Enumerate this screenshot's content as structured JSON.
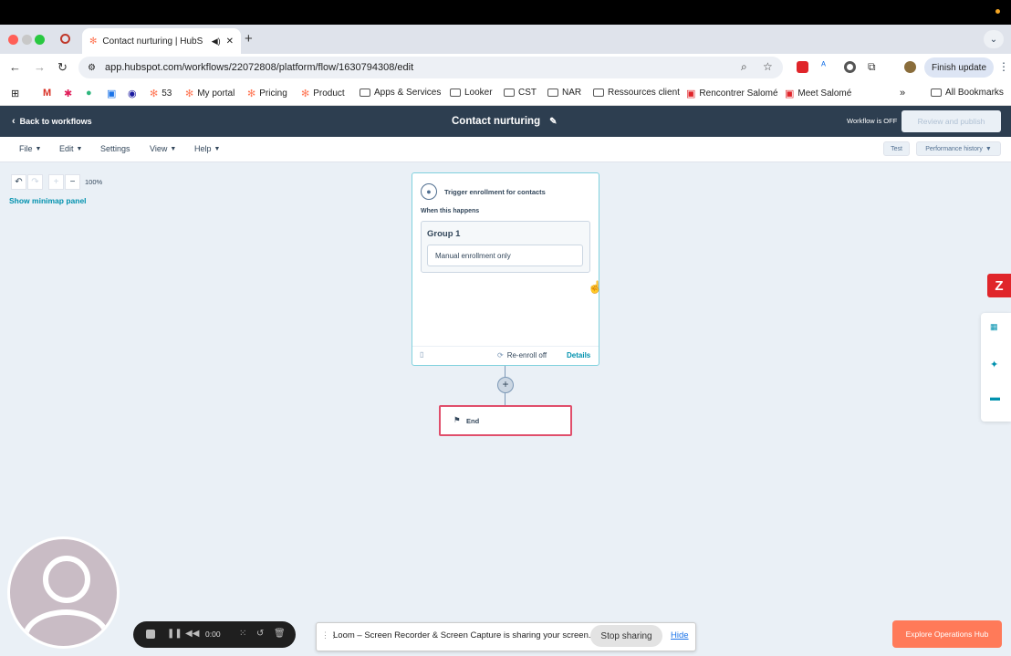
{
  "browser": {
    "tab_title": "Contact nurturing | HubS",
    "address": "app.hubspot.com/workflows/22072808/platform/flow/1630794308/edit",
    "finish_update": "Finish update",
    "bookmarks": [
      "53",
      "My portal",
      "Pricing",
      "Product",
      "Apps & Services",
      "Looker",
      "CST",
      "NAR",
      "Ressources client",
      "Rencontrer Salomé",
      "Meet Salomé"
    ],
    "all_bookmarks": "All Bookmarks"
  },
  "header": {
    "back_label": "Back to workflows",
    "title": "Contact nurturing",
    "status": "Workflow is OFF",
    "review_label": "Review and publish"
  },
  "menu": {
    "file": "File",
    "edit": "Edit",
    "settings": "Settings",
    "view": "View",
    "help": "Help",
    "test": "Test",
    "performance": "Performance history"
  },
  "canvas": {
    "zoom": "100%",
    "minimap": "Show minimap panel"
  },
  "trigger": {
    "title": "Trigger enrollment for contacts",
    "when_label": "When this happens",
    "group_title": "Group 1",
    "group_value": "Manual enrollment only",
    "reenroll": "Re-enroll off",
    "details": "Details"
  },
  "end_node": {
    "label": "End"
  },
  "loom": {
    "time": "0:00",
    "share_text": "Loom – Screen Recorder & Screen Capture is sharing your screen.",
    "stop_label": "Stop sharing",
    "hide_label": "Hide"
  },
  "explore": {
    "label": "Explore Operations Hub"
  },
  "zendesk": {
    "label": "Z"
  },
  "colors": {
    "hubspot_header": "#2d3e50",
    "accent_teal": "#0091ae",
    "end_border": "#e04e6b",
    "cta_orange": "#ff7a59"
  }
}
